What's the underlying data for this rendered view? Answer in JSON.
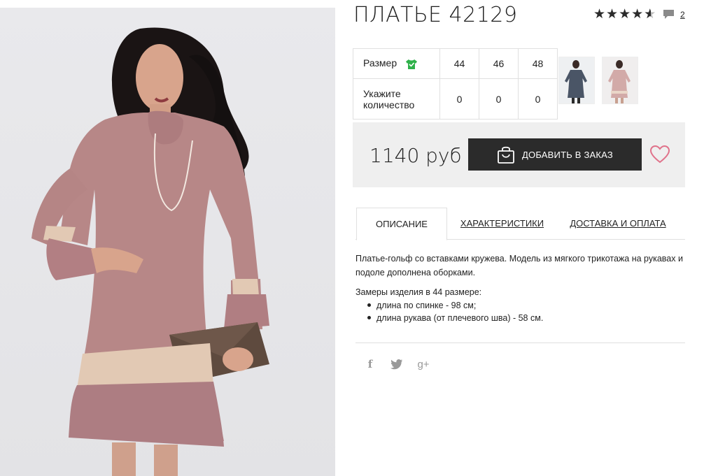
{
  "product": {
    "title": "ПЛАТЬЕ 42129",
    "rating": 4.5,
    "comment_count": "2",
    "photo": "model-in-pink-dress",
    "thumbnails": [
      "dress-grey-thumbnail",
      "dress-pink-thumbnail"
    ]
  },
  "size_table": {
    "size_label": "Размер",
    "qty_label_1": "Укажите",
    "qty_label_2": "количество",
    "sizes": [
      "44",
      "46",
      "48"
    ],
    "quantities": [
      "0",
      "0",
      "0"
    ]
  },
  "price_box": {
    "price": "1140 руб",
    "order_button": "ДОБАВИТЬ В ЗАКАЗ",
    "button_color": "#2b2b2b",
    "heart_color": "#e0728a"
  },
  "tabs": {
    "description": "ОПИСАНИЕ",
    "characteristics": "ХАРАКТЕРИСТИКИ",
    "delivery": "ДОСТАВКА И ОПЛАТА"
  },
  "description": {
    "paragraph": "Платье-гольф со вставками кружева. Модель из мягкого трикотажа на рукавах и подоле дополнена оборками.",
    "measure_title": "Замеры изделия в 44 размере:",
    "items": [
      "длина по спинке - 98 см;",
      "длина рукава (от плечевого шва) - 58 см."
    ]
  },
  "social": {
    "facebook": "f",
    "google_plus": "g+"
  }
}
